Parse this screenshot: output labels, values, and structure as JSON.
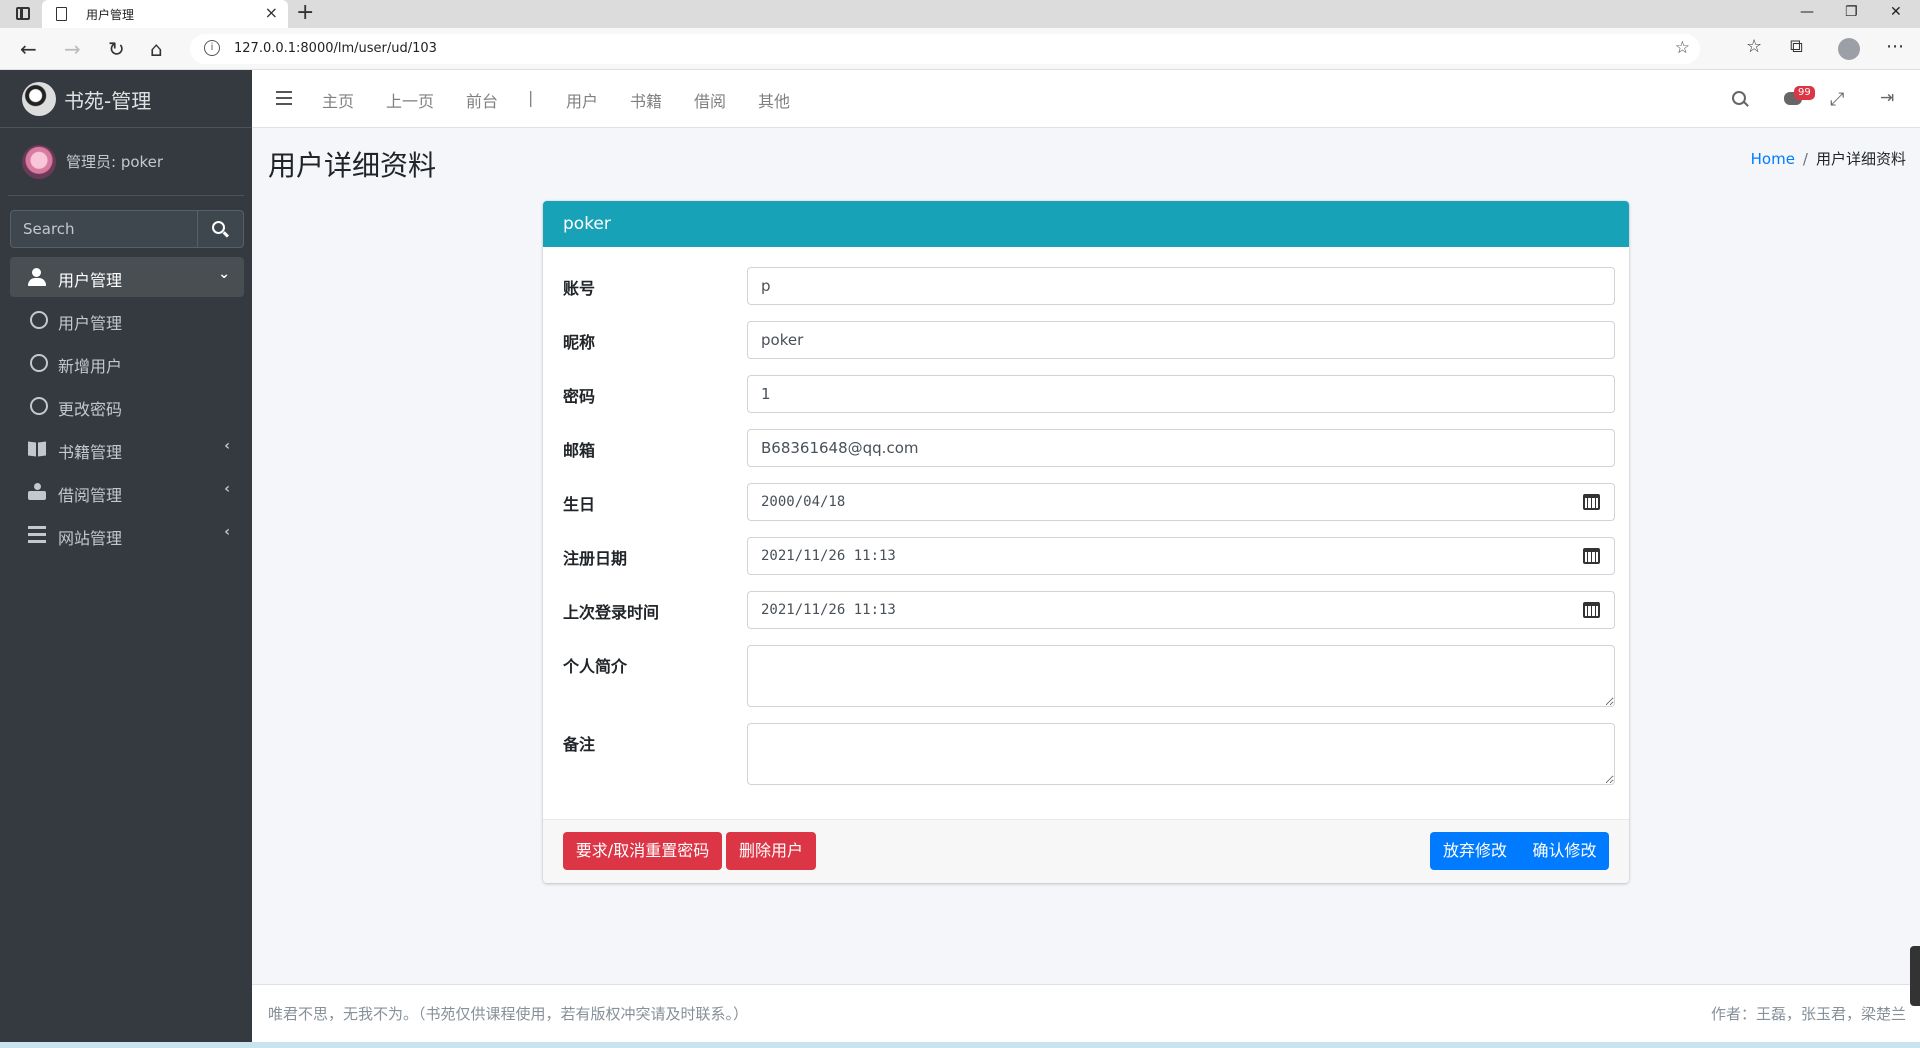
{
  "browser": {
    "tab_title": "用户管理",
    "url": "127.0.0.1:8000/lm/user/ud/103"
  },
  "sidebar": {
    "brand": "书苑-管理",
    "user": "管理员: poker",
    "search_placeholder": "Search",
    "menu": [
      {
        "label": "用户管理",
        "icon": "user-icon",
        "expanded": true
      },
      {
        "label": "用户管理",
        "icon": "circle-icon"
      },
      {
        "label": "新增用户",
        "icon": "circle-icon"
      },
      {
        "label": "更改密码",
        "icon": "circle-icon"
      },
      {
        "label": "书籍管理",
        "icon": "book-icon"
      },
      {
        "label": "借阅管理",
        "icon": "borrow-icon"
      },
      {
        "label": "网站管理",
        "icon": "bars-icon"
      }
    ]
  },
  "topnav": {
    "links": [
      "主页",
      "上一页",
      "前台",
      "用户",
      "书籍",
      "借阅",
      "其他"
    ],
    "separator": "|",
    "badge": "99"
  },
  "page": {
    "title": "用户详细资料",
    "breadcrumb_home": "Home",
    "breadcrumb_sep": "/",
    "breadcrumb_current": "用户详细资料"
  },
  "card": {
    "header": "poker",
    "fields": [
      {
        "label": "账号",
        "value": "p"
      },
      {
        "label": "昵称",
        "value": "poker"
      },
      {
        "label": "密码",
        "value": "1"
      },
      {
        "label": "邮箱",
        "value": "B68361648@qq.com"
      },
      {
        "label": "生日",
        "value": "2000/04/18"
      },
      {
        "label": "注册日期",
        "value": "2021/11/26 11:13"
      },
      {
        "label": "上次登录时间",
        "value": "2021/11/26 11:13"
      },
      {
        "label": "个人简介",
        "value": ""
      },
      {
        "label": "备注",
        "value": ""
      }
    ],
    "buttons": {
      "reset_password": "要求/取消重置密码",
      "delete_user": "删除用户",
      "discard": "放弃修改",
      "confirm": "确认修改"
    }
  },
  "footer": {
    "left": "唯君不思，无我不为。（书苑仅供课程使用，若有版权冲突请及时联系。）",
    "right": "作者：王磊，张玉君，梁楚兰"
  },
  "colors": {
    "sidebar_bg": "#343a40",
    "card_header": "#17a2b8",
    "danger": "#dc3545",
    "primary": "#007bff"
  }
}
